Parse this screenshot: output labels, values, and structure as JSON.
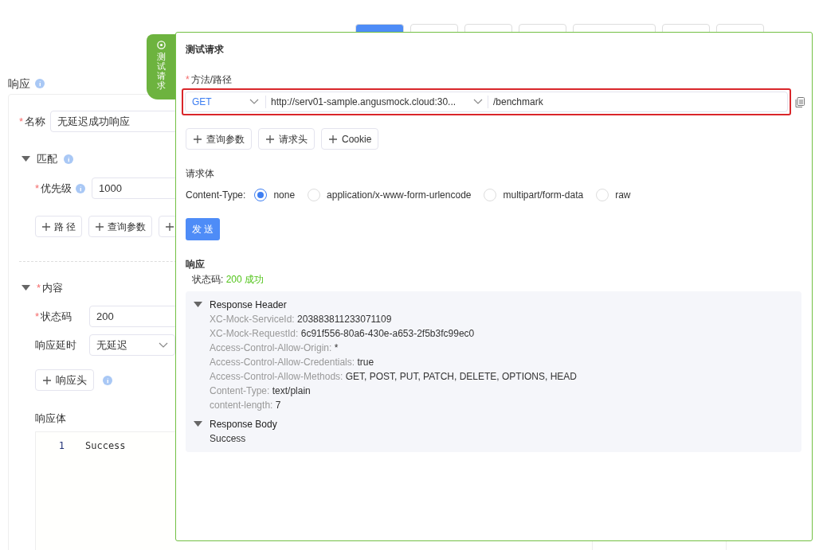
{
  "toolbar": {
    "buttons": [
      {
        "kind": "primary"
      },
      {
        "kind": "default"
      },
      {
        "kind": "default"
      },
      {
        "kind": "default"
      },
      {
        "kind": "wide"
      },
      {
        "kind": "default"
      },
      {
        "kind": "default"
      }
    ]
  },
  "response": {
    "title": "响应",
    "name": {
      "mark": "*",
      "label": "名称",
      "value": "无延迟成功响应"
    },
    "match": {
      "title": "匹配",
      "expanded": true,
      "priority": {
        "mark": "*",
        "label": "优先级",
        "value": "1000"
      },
      "add_buttons": [
        {
          "kind": "labeled",
          "label": "路 径"
        },
        {
          "kind": "labeled",
          "label": "查询参数"
        },
        {
          "kind": "cut"
        }
      ]
    },
    "content": {
      "mark": "*",
      "title": "内容",
      "expanded": true,
      "status_code": {
        "mark": "*",
        "label": "状态码",
        "value": "200"
      },
      "delay": {
        "label": "响应延时",
        "value": "无延迟"
      },
      "header_button": "响应头",
      "body_label": "响应体",
      "code_lines": [
        {
          "number": "1",
          "text": "Success"
        }
      ]
    }
  },
  "drawer": {
    "tab": "测试请求",
    "title": "测试请求",
    "method_path": {
      "mark": "*",
      "label": "方法/路径",
      "highlighted": true,
      "method": "GET",
      "server": "http://serv01-sample.angusmock.cloud:30...",
      "path": "/benchmark"
    },
    "param_buttons": [
      "查询参数",
      "请求头",
      "Cookie"
    ],
    "body": {
      "title": "请求体",
      "content_type_label": "Content-Type:",
      "options": [
        {
          "label": "none",
          "selected": true
        },
        {
          "label": "application/x-www-form-urlencode",
          "selected": false
        },
        {
          "label": "multipart/form-data",
          "selected": false
        },
        {
          "label": "raw",
          "selected": false
        }
      ]
    },
    "send_button": "发 送",
    "result": {
      "title": "响应",
      "status_label": "状态码:",
      "status_value": "200 成功",
      "sections": [
        {
          "kind": "rows",
          "title": "Response Header",
          "expanded": true,
          "rows": [
            {
              "key": "XC-Mock-ServiceId:",
              "value": "203883811233071109"
            },
            {
              "key": "XC-Mock-RequestId:",
              "value": "6c91f556-80a6-430e-a653-2f5b3fc99ec0"
            },
            {
              "key": "Access-Control-Allow-Origin:",
              "value": "*"
            },
            {
              "key": "Access-Control-Allow-Credentials:",
              "value": "true"
            },
            {
              "key": "Access-Control-Allow-Methods:",
              "value": "GET, POST, PUT, PATCH, DELETE, OPTIONS, HEAD"
            },
            {
              "key": "Content-Type:",
              "value": "text/plain"
            },
            {
              "key": "content-length:",
              "value": "7"
            }
          ]
        },
        {
          "kind": "text",
          "title": "Response Body",
          "expanded": true,
          "text": "Success"
        }
      ]
    }
  }
}
